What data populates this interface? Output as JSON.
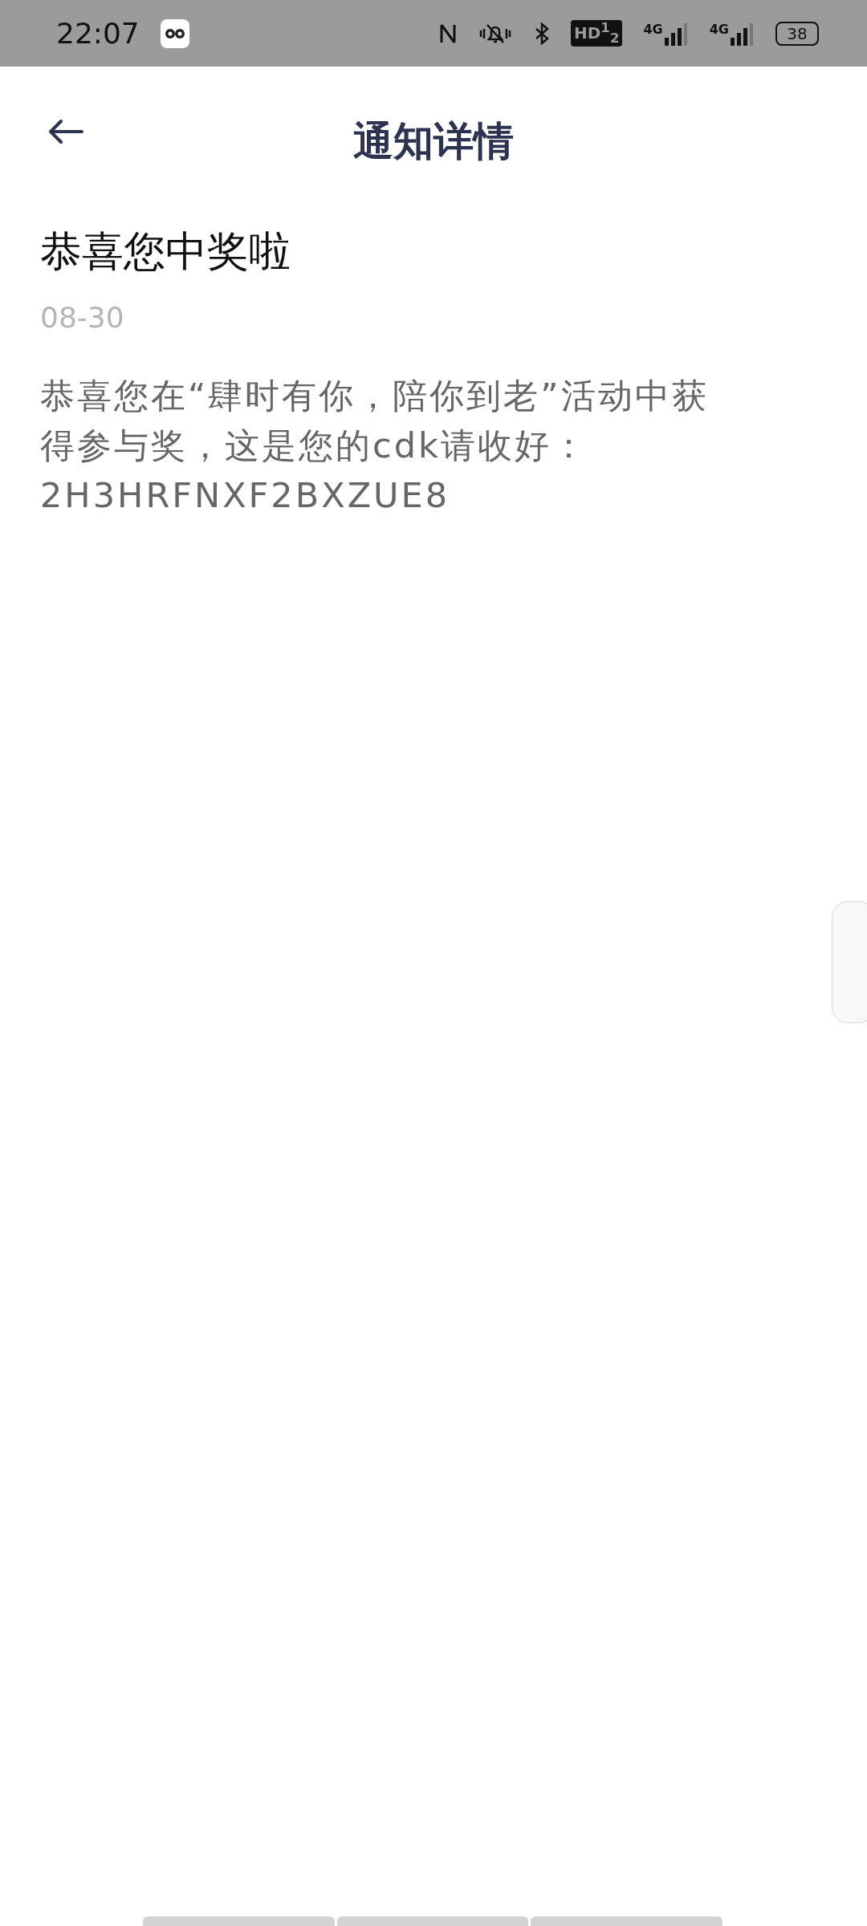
{
  "status_bar": {
    "time": "22:07",
    "hd": "HD$^{1}$$_{2}$",
    "networks": [
      "4G",
      "4G"
    ],
    "battery": "38"
  },
  "header": {
    "title": "通知详情"
  },
  "notice": {
    "title": "恭喜您中奖啦",
    "date": "08-30",
    "body": "恭喜您在“肆时有你，陪你到老”活动中获得参与奖，这是您的cdk请收好：2H3HRFNXF2BXZUE8"
  }
}
